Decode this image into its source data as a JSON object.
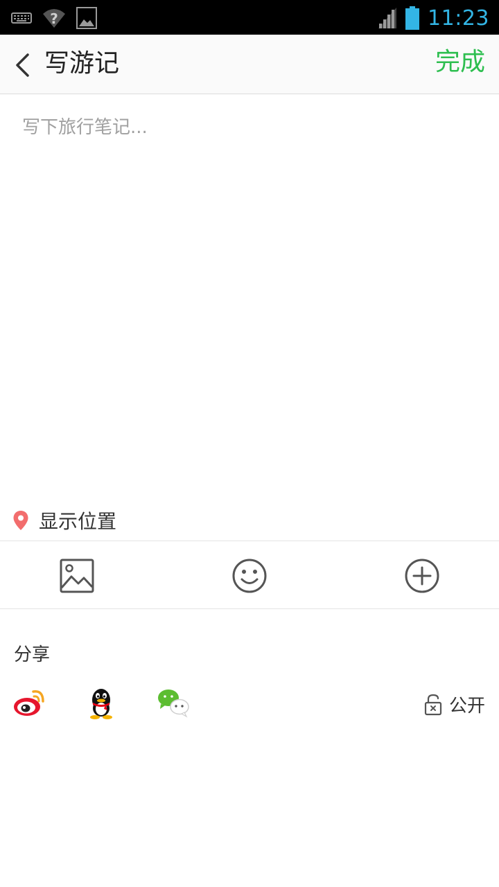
{
  "status_bar": {
    "time": "11:23",
    "icons": [
      "keyboard-icon",
      "wifi-unknown-icon",
      "gallery-icon",
      "signal-icon",
      "battery-icon"
    ],
    "time_color": "#33b5e5"
  },
  "header": {
    "title": "写游记",
    "done_label": "完成",
    "done_color": "#2dbe4f"
  },
  "editor": {
    "placeholder": "写下旅行笔记..."
  },
  "location": {
    "label": "显示位置",
    "icon": "location-pin-icon",
    "icon_color": "#f26d6d"
  },
  "toolbar": {
    "buttons": [
      "image-icon",
      "emoji-icon",
      "add-icon"
    ]
  },
  "share": {
    "label": "分享",
    "platforms": [
      "weibo-icon",
      "qq-icon",
      "wechat-icon"
    ],
    "privacy_label": "公开",
    "privacy_icon": "unlock-icon"
  }
}
